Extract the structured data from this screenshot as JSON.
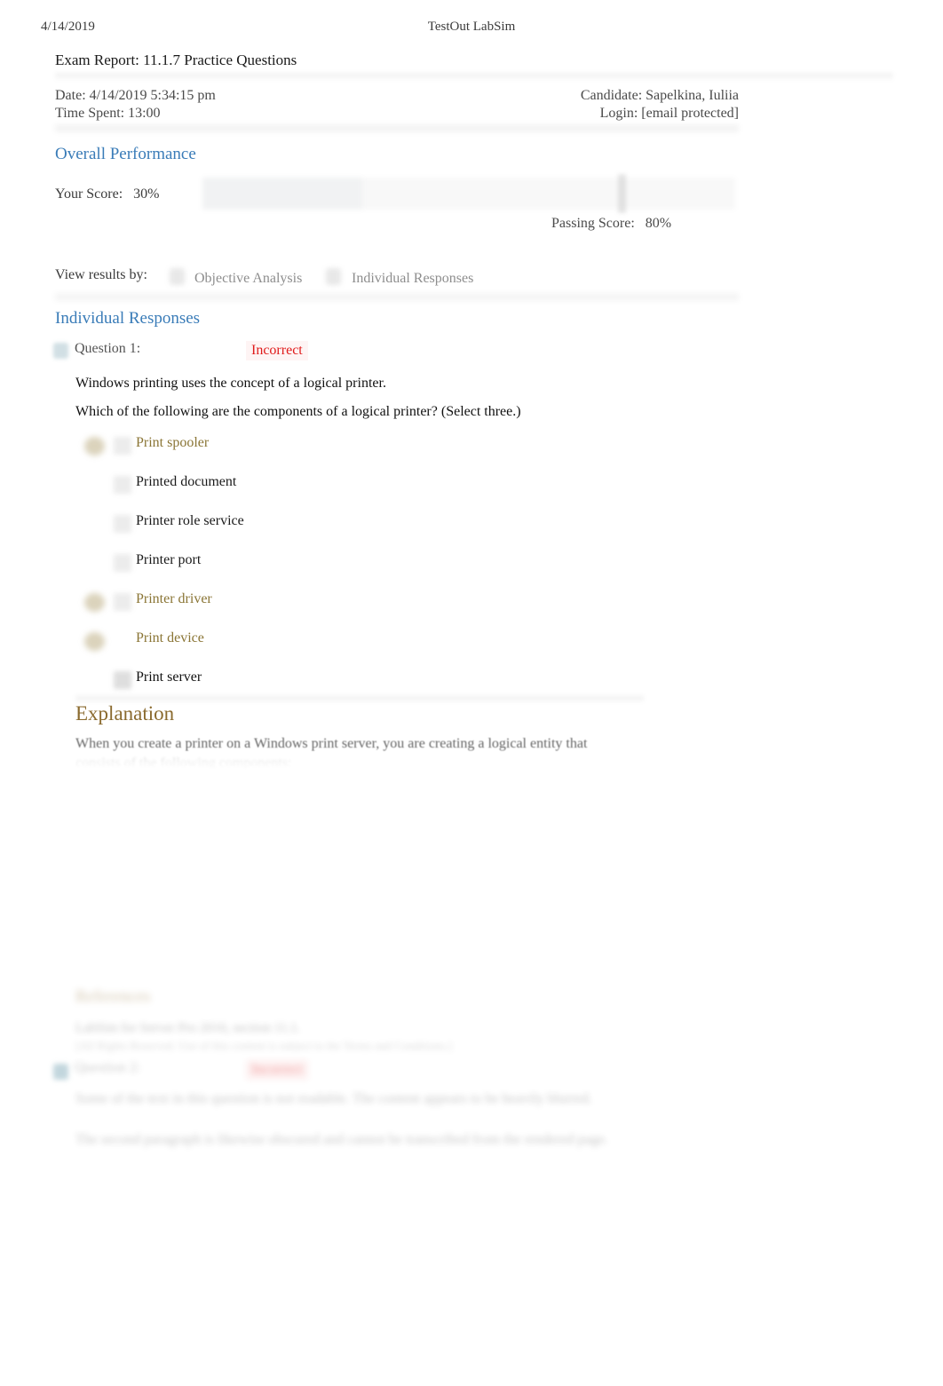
{
  "print_header": {
    "date": "4/14/2019",
    "app_title": "TestOut LabSim"
  },
  "report": {
    "title": "Exam Report: 11.1.7 Practice Questions",
    "date_label": "Date: 4/14/2019 5:34:15 pm",
    "time_spent_label": "Time Spent: 13:00",
    "candidate_label": "Candidate: Sapelkina, Iuliia",
    "login_label": "Login: [email protected]"
  },
  "overall_performance": {
    "heading": "Overall Performance",
    "your_score_label": "Your Score:   30%",
    "passing_score_label": "Passing Score:   80%",
    "your_score_percent": 30,
    "passing_score_percent": 80
  },
  "view_results": {
    "label": "View results by:",
    "options": [
      {
        "label": "Objective Analysis",
        "selected": false
      },
      {
        "label": "Individual Responses",
        "selected": true
      }
    ]
  },
  "individual_responses": {
    "heading": "Individual Responses",
    "questions": [
      {
        "number_label": "Question 1:",
        "status": "Incorrect",
        "status_color": "#e01b1b",
        "stem_lines": [
          "Windows printing uses the concept of a logical printer.",
          "Which of the following are the components of a logical printer? (Select three.)"
        ],
        "options": [
          {
            "label": "Print spooler",
            "marked": true,
            "checkbox": true,
            "emphasis": "selected"
          },
          {
            "label": "Printed document",
            "marked": false,
            "checkbox": true,
            "emphasis": "normal"
          },
          {
            "label": "Printer role service",
            "marked": false,
            "checkbox": true,
            "emphasis": "normal"
          },
          {
            "label": "Printer port",
            "marked": false,
            "checkbox": true,
            "emphasis": "normal"
          },
          {
            "label": "Printer driver",
            "marked": true,
            "checkbox": true,
            "emphasis": "selected"
          },
          {
            "label": "Print device",
            "marked": true,
            "checkbox": false,
            "emphasis": "selected"
          },
          {
            "label": "Print server",
            "marked": false,
            "checkbox": true,
            "emphasis": "strong"
          }
        ],
        "explanation": {
          "heading": "Explanation",
          "line1": "When you create a printer on a Windows print server, you are creating a logical entity that",
          "line2": "consists of the following components:"
        },
        "references": {
          "heading": "References",
          "line1": "LabSim for Server Pro 2016, section 11.1.",
          "line2": "[All Rights Reserved. Use of this content is subject to the Terms and Conditions.]"
        }
      },
      {
        "number_label": "Question 2:",
        "status": "Incorrect",
        "status_color": "#e01b1b",
        "body_lines": [
          "Some of the text in this question is not readable. The content appears to be heavily blurred.",
          "The second paragraph is likewise obscured and cannot be transcribed from the rendered page."
        ]
      }
    ]
  },
  "colors": {
    "heading_blue": "#3a7cb8",
    "explanation_brown": "#8a6a2e",
    "selected_option": "#8a7535",
    "incorrect_red": "#e01b1b",
    "body_text": "#111111",
    "muted_text": "#8d8d8d",
    "page_background": "#ffffff"
  }
}
